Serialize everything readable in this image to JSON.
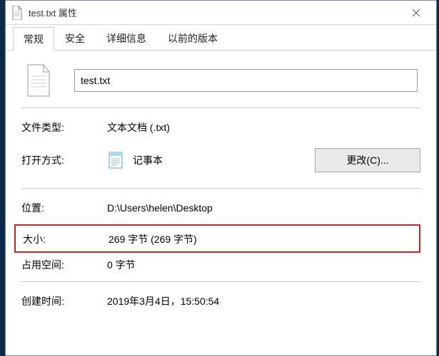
{
  "titlebar": {
    "title": "test.txt 属性"
  },
  "tabs": {
    "t0": "常规",
    "t1": "安全",
    "t2": "详细信息",
    "t3": "以前的版本"
  },
  "file": {
    "name": "test.txt"
  },
  "labels": {
    "filetype": "文件类型:",
    "openwith": "打开方式:",
    "location": "位置:",
    "size": "大小:",
    "sizeondisk": "占用空间:",
    "created": "创建时间:"
  },
  "values": {
    "filetype": "文本文档 (.txt)",
    "openwith_app": "记事本",
    "location": "D:\\Users\\helen\\Desktop",
    "size": "269 字节 (269 字节)",
    "sizeondisk": "0 字节",
    "created": "2019年3月4日，15:50:54"
  },
  "buttons": {
    "change": "更改(C)..."
  }
}
